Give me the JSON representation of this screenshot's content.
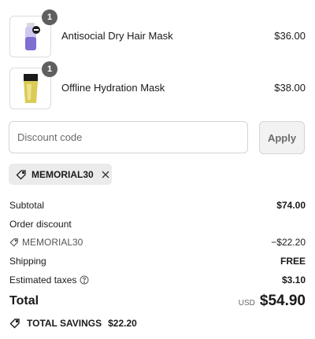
{
  "items": [
    {
      "name": "Antisocial Dry Hair Mask",
      "price": "$36.00",
      "quantity": "1"
    },
    {
      "name": "Offline Hydration Mask",
      "price": "$38.00",
      "quantity": "1"
    }
  ],
  "discount": {
    "placeholder": "Discount code",
    "value": "",
    "apply_label": "Apply",
    "applied_code": "MEMORIAL30"
  },
  "summary": {
    "subtotal_label": "Subtotal",
    "subtotal_value": "$74.00",
    "order_discount_label": "Order discount",
    "discount_code": "MEMORIAL30",
    "discount_value": "−$22.20",
    "shipping_label": "Shipping",
    "shipping_value": "FREE",
    "taxes_label": "Estimated taxes",
    "taxes_value": "$3.10",
    "total_label": "Total",
    "currency": "USD",
    "total_value": "$54.90"
  },
  "savings": {
    "label": "TOTAL SAVINGS",
    "value": "$22.20"
  },
  "colors": {
    "badge": "#5f5f5f",
    "chip_bg": "#ebebeb",
    "apply_bg": "#f2f2f2",
    "border": "#d4d4d4"
  }
}
